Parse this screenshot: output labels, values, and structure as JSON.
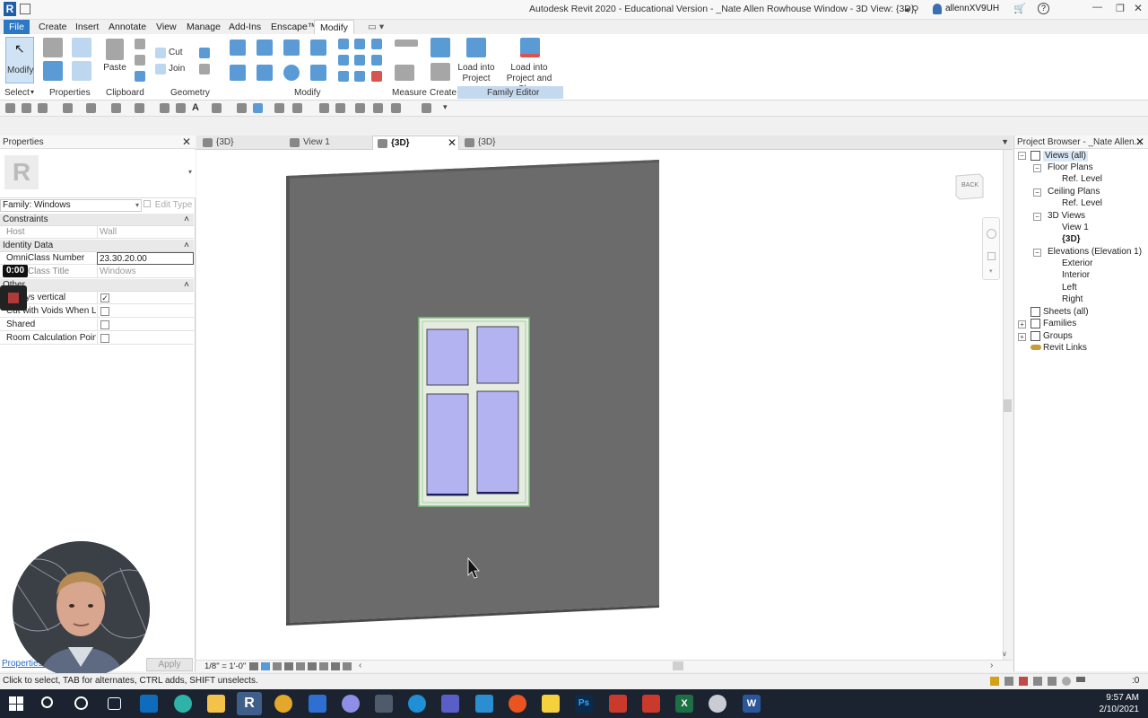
{
  "window": {
    "title": "Autodesk Revit 2020 - Educational Version - _Nate Allen Rowhouse Window - 3D View: {3D}",
    "user": "allennXV9UH"
  },
  "ribbon_tabs": [
    "File",
    "Create",
    "Insert",
    "Annotate",
    "View",
    "Manage",
    "Add-Ins",
    "Enscape™",
    "Modify"
  ],
  "ribbon": {
    "modify_label": "Modify",
    "paste_label": "Paste",
    "cut_label": "Cut",
    "join_label": "Join",
    "load_into_project": "Load into\nProject",
    "load_into_project_close": "Load into\nProject and Close",
    "panels": {
      "select": "Select",
      "properties": "Properties",
      "clipboard": "Clipboard",
      "geometry": "Geometry",
      "modify": "Modify",
      "measure": "Measure",
      "create": "Create",
      "family_editor": "Family Editor"
    }
  },
  "properties": {
    "title": "Properties",
    "type_selector": "Family: Windows",
    "edit_type": "Edit Type",
    "groups": {
      "constraints": "Constraints",
      "identity": "Identity Data",
      "other": "Other"
    },
    "rows": {
      "host_key": "Host",
      "host_val": "Wall",
      "omni_num_key": "OmniClass Number",
      "omni_num_val": "23.30.20.00",
      "omni_title_key": "OmniClass Title",
      "omni_title_val": "Windows",
      "vertical_key": "Always vertical",
      "cut_voids_key": "Cut with Voids When L...",
      "shared_key": "Shared",
      "room_calc_key": "Room Calculation Point"
    },
    "help_link": "Properties help",
    "apply": "Apply"
  },
  "recording": {
    "timer": "0:00"
  },
  "view_tabs": [
    "{3D}",
    "View 1",
    "{3D}",
    "{3D}"
  ],
  "viewcube_label": "BACK",
  "view_control": {
    "scale": "1/8\" = 1'-0\""
  },
  "project_browser": {
    "title": "Project Browser - _Nate Allen...",
    "tree": {
      "views": "Views (all)",
      "floor_plans": "Floor Plans",
      "fp_ref": "Ref. Level",
      "ceiling_plans": "Ceiling Plans",
      "cp_ref": "Ref. Level",
      "views_3d": "3D Views",
      "view1": "View 1",
      "view_3d": "{3D}",
      "elevations": "Elevations (Elevation 1)",
      "exterior": "Exterior",
      "interior": "Interior",
      "left": "Left",
      "right": "Right",
      "sheets": "Sheets (all)",
      "families": "Families",
      "groups": "Groups",
      "revit_links": "Revit Links"
    }
  },
  "status": {
    "text": "Click to select, TAB for alternates, CTRL adds, SHIFT unselects.",
    "filter_count": ":0"
  },
  "taskbar": {
    "time": "9:57 AM",
    "date": "2/10/2021"
  },
  "colors": {
    "accent": "#2b78c5",
    "wall": "#6b6b6b",
    "glass": "#b4b3f2",
    "frame": "#e9ece6"
  }
}
